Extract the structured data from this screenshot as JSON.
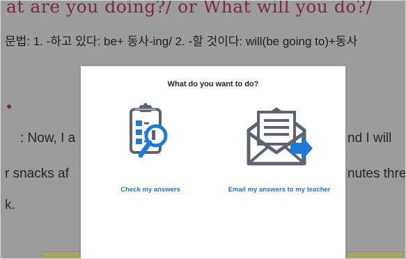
{
  "background": {
    "title": "at are you doing?/ or What will you do?/",
    "grammar": "문법: 1. -하고 있다: be+ 동사-ing/ 2. -할 것이다: will(be going to)+동사",
    "bullet": "●",
    "lines": [
      {
        "left": ": Now, I a",
        "right": "nd I will"
      },
      {
        "left": "r snacks af",
        "right": "nutes thre"
      },
      {
        "left": "k.",
        "right": ""
      }
    ]
  },
  "dialog": {
    "title": "What do you want to do?",
    "options": [
      {
        "label": "Check my answers",
        "icon": "clipboard-magnifier-icon"
      },
      {
        "label": "Email my answers to my teacher",
        "icon": "envelope-send-icon"
      }
    ]
  },
  "colors": {
    "link": "#2f6fb6",
    "icon_dark": "#5d6470",
    "icon_blue": "#1f79d6",
    "overlay": "#9c9c9c"
  }
}
